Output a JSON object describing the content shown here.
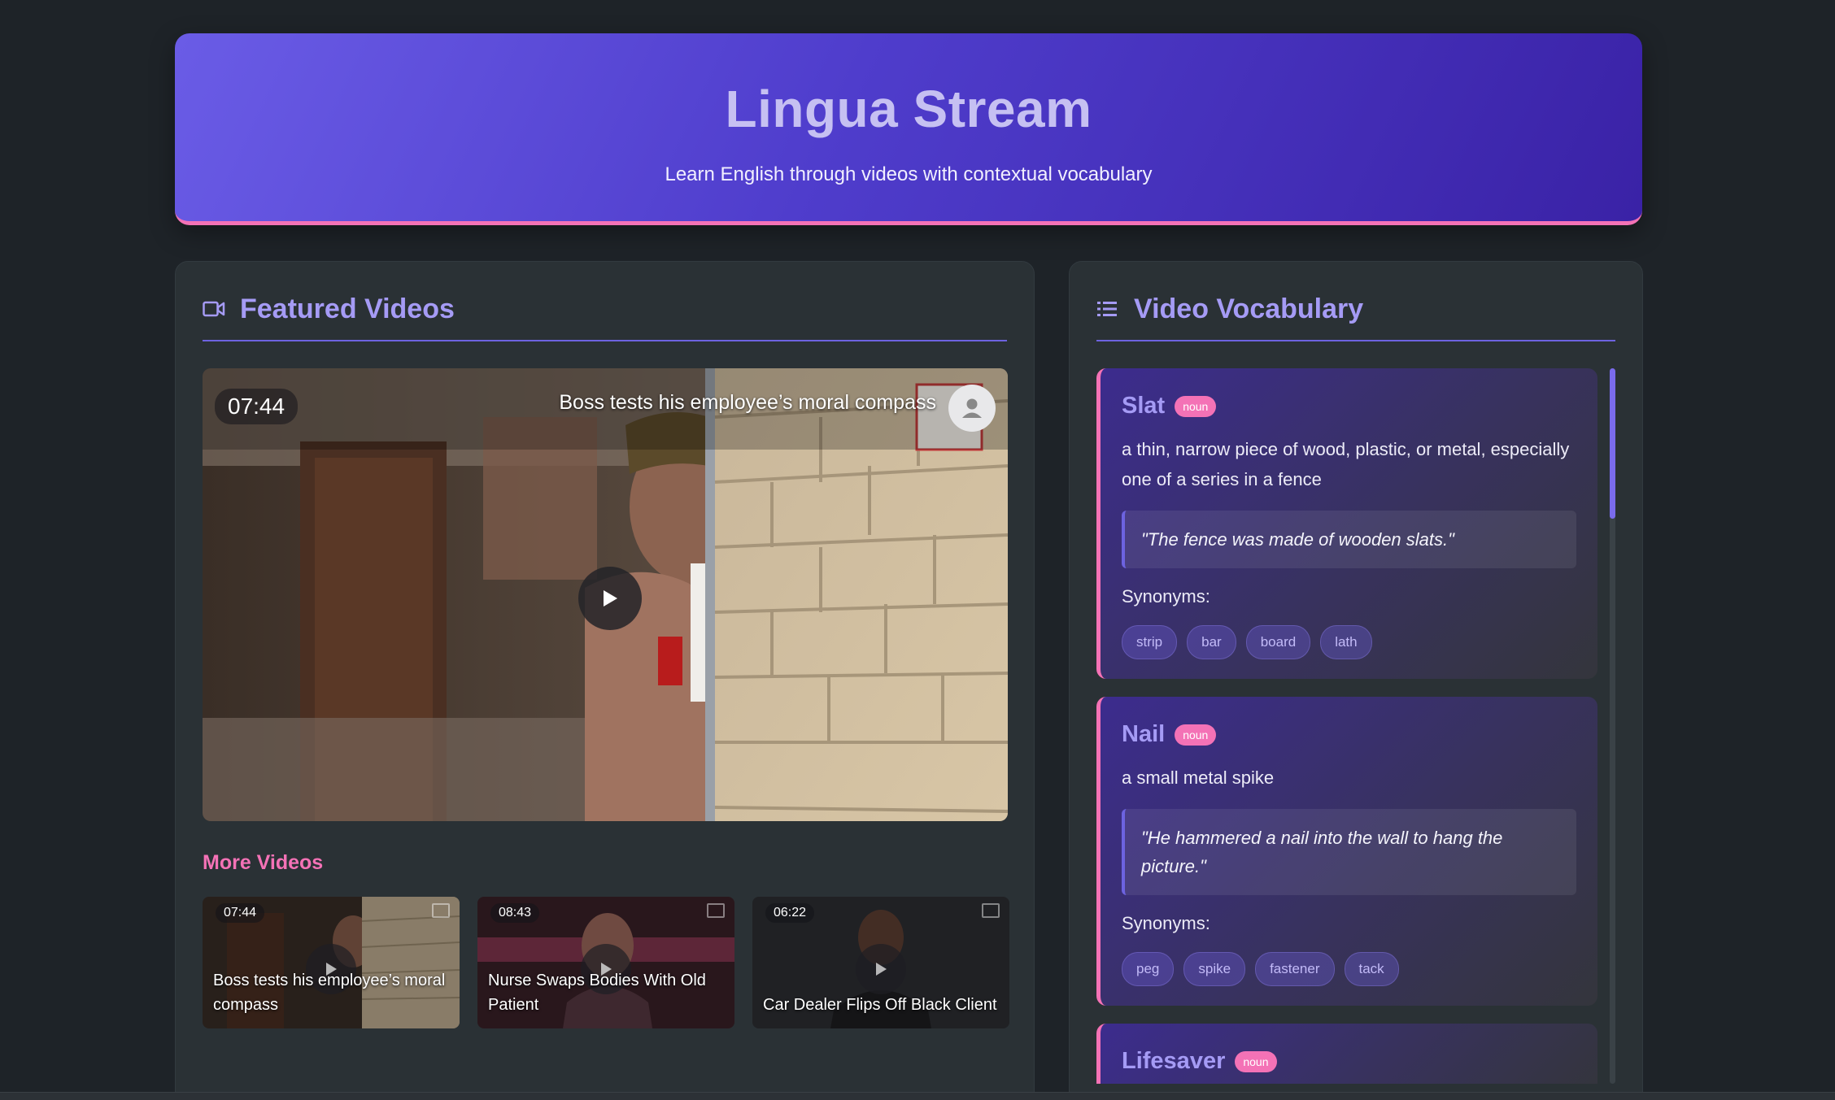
{
  "header": {
    "title": "Lingua Stream",
    "subtitle": "Learn English through videos with contextual vocabulary"
  },
  "featured": {
    "heading": "Featured Videos",
    "icon": "video-camera-icon",
    "player": {
      "time": "07:44",
      "title": "Boss tests his employee’s moral compass",
      "channel_avatar_icon": "user-icon",
      "play_icon": "play-icon"
    },
    "more_heading": "More Videos",
    "more": [
      {
        "time": "07:44",
        "title": "Boss tests his employee’s moral compass"
      },
      {
        "time": "08:43",
        "title": "Nurse Swaps Bodies With Old Patient"
      },
      {
        "time": "06:22",
        "title": "Car Dealer Flips Off Black Client"
      }
    ]
  },
  "vocabulary": {
    "heading": "Video Vocabulary",
    "icon": "list-icon",
    "synonyms_label": "Synonyms:",
    "cards": [
      {
        "word": "Slat",
        "pos": "noun",
        "definition": "a thin, narrow piece of wood, plastic, or metal, especially one of a series in a fence",
        "example": "\"The fence was made of wooden slats.\"",
        "synonyms": [
          "strip",
          "bar",
          "board",
          "lath"
        ]
      },
      {
        "word": "Nail",
        "pos": "noun",
        "definition": "a small metal spike",
        "example": "\"He hammered a nail into the wall to hang the picture.\"",
        "synonyms": [
          "peg",
          "spike",
          "fastener",
          "tack"
        ]
      },
      {
        "word": "Lifesaver",
        "pos": "noun",
        "definition": "",
        "example": "",
        "synonyms": []
      }
    ]
  },
  "colors": {
    "accent": "#6d63e0",
    "pink": "#f472b6",
    "background": "#1e2328",
    "panel": "#2a3135"
  }
}
